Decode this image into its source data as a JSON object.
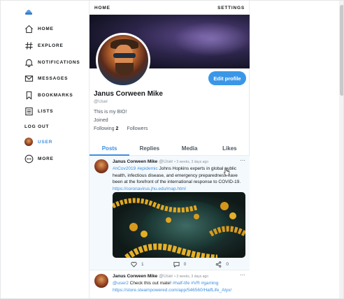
{
  "sidebar": {
    "items": [
      {
        "label": "HOME",
        "icon": "home-icon"
      },
      {
        "label": "EXPLORE",
        "icon": "hashtag-icon"
      },
      {
        "label": "NOTIFICATIONS",
        "icon": "bell-icon"
      },
      {
        "label": "MESSAGES",
        "icon": "envelope-icon"
      },
      {
        "label": "BOOKMARKS",
        "icon": "bookmark-icon"
      },
      {
        "label": "LISTS",
        "icon": "list-icon"
      }
    ],
    "logout": "LOG OUT",
    "user": "USER",
    "more": "MORE"
  },
  "header": {
    "home": "HOME",
    "settings": "SETTINGS"
  },
  "profile": {
    "name": "Janus Corween Mike",
    "handle": "@User",
    "bio": "This is my BIO!",
    "joined": "Joined",
    "following_label": "Following",
    "following_count": "2",
    "followers_label": "Followers",
    "edit_label": "Edit profile"
  },
  "tabs": [
    "Posts",
    "Replies",
    "Media",
    "Likes"
  ],
  "posts": [
    {
      "name": "Janus Corween Mike",
      "handle": "@User",
      "time": "• 3 weeks, 3 days ago",
      "tag1": "#nCov2019",
      "tag2": "#epidemic",
      "body": " Johns Hopkins experts in global public health, infectious disease, and emergency preparedness have been at the forefront of the international response to COVID-19.",
      "link": "https://coronavirus.jhu.edu/map.html",
      "likes": "1",
      "comments": "0",
      "shares": "0"
    },
    {
      "name": "Janus Corween Mike",
      "handle": "@User",
      "time": "• 3 weeks, 3 days ago",
      "mention": "@user2",
      "body": " Check this out mate! ",
      "tag1": "#half-life",
      "tag2": "#VR",
      "tag3": "#gaming",
      "link": "https://store.steampowered.com/app/546560/HalfLife_Alyx/"
    }
  ],
  "colors": {
    "accent": "#3b8fe3",
    "button": "#3a97e8"
  }
}
